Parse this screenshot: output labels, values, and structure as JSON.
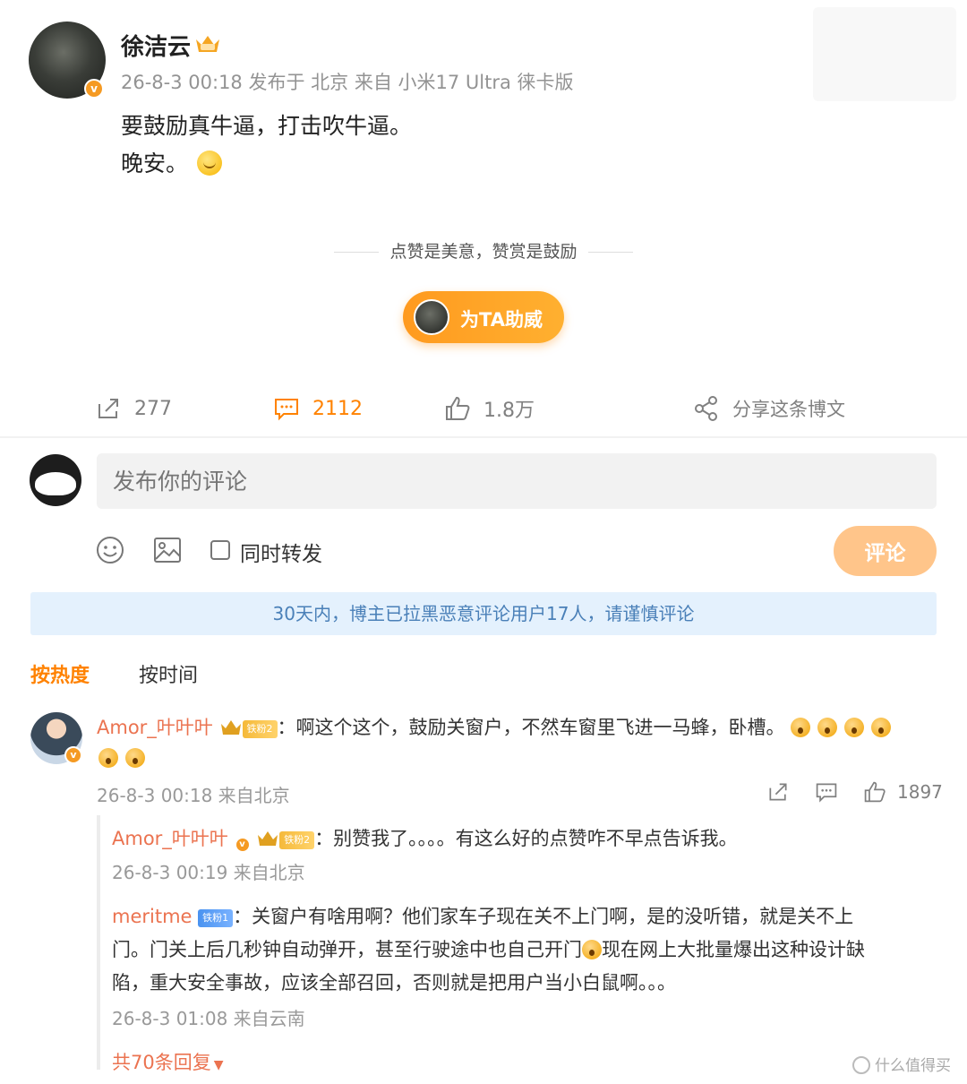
{
  "post": {
    "author": "徐洁云",
    "meta": "26-8-3 00:18 发布于 北京 来自 小米17 Ultra 徕卡版",
    "line1": "要鼓励真牛逼，打击吹牛逼。",
    "line2": "晚安。"
  },
  "reward": {
    "tagline": "点赞是美意，赞赏是鼓励",
    "button_label": "为TA助威"
  },
  "actions": {
    "repost_count": "277",
    "comment_count": "2112",
    "like_count": "1.8万",
    "share_label": "分享这条博文"
  },
  "composer": {
    "placeholder": "发布你的评论",
    "repost_label": "同时转发",
    "submit_label": "评论"
  },
  "notice": "30天内，博主已拉黑恶意评论用户17人，请谨慎评论",
  "sort": {
    "hot": "按热度",
    "time": "按时间"
  },
  "comment": {
    "user": "Amor_叶叶叶",
    "level": "铁粉2",
    "text": "：啊这个这个，鼓励关窗户，不然车窗里飞进一马蜂，卧槽。",
    "meta": "26-8-3 00:18 来自北京",
    "likes": "1897"
  },
  "replies": [
    {
      "user": "Amor_叶叶叶",
      "level": "铁粉2",
      "text": "：别赞我了。。。。有这么好的点赞咋不早点告诉我。",
      "meta": "26-8-3 00:19 来自北京"
    },
    {
      "user": "meritme",
      "level": "铁粉1",
      "text1": "：关窗户有啥用啊？他们家车子现在关不上门啊，是的没听错，就是关不上",
      "text2a": "门。门关上后几秒钟自动弹开，甚至行驶途中也自己开门",
      "text2b": "现在网上大批量爆出这种设计缺",
      "text3": "陷，重大安全事故，应该全部召回，否则就是把用户当小白鼠啊。。。",
      "meta": "26-8-3 01:08 来自云南"
    }
  ],
  "more_replies": "共70条回复",
  "watermark": "什么值得买",
  "colors": {
    "accent": "#ff8200",
    "username": "#eb7350",
    "notice_bg": "#e4f1fd",
    "notice_text": "#4a80b8"
  }
}
